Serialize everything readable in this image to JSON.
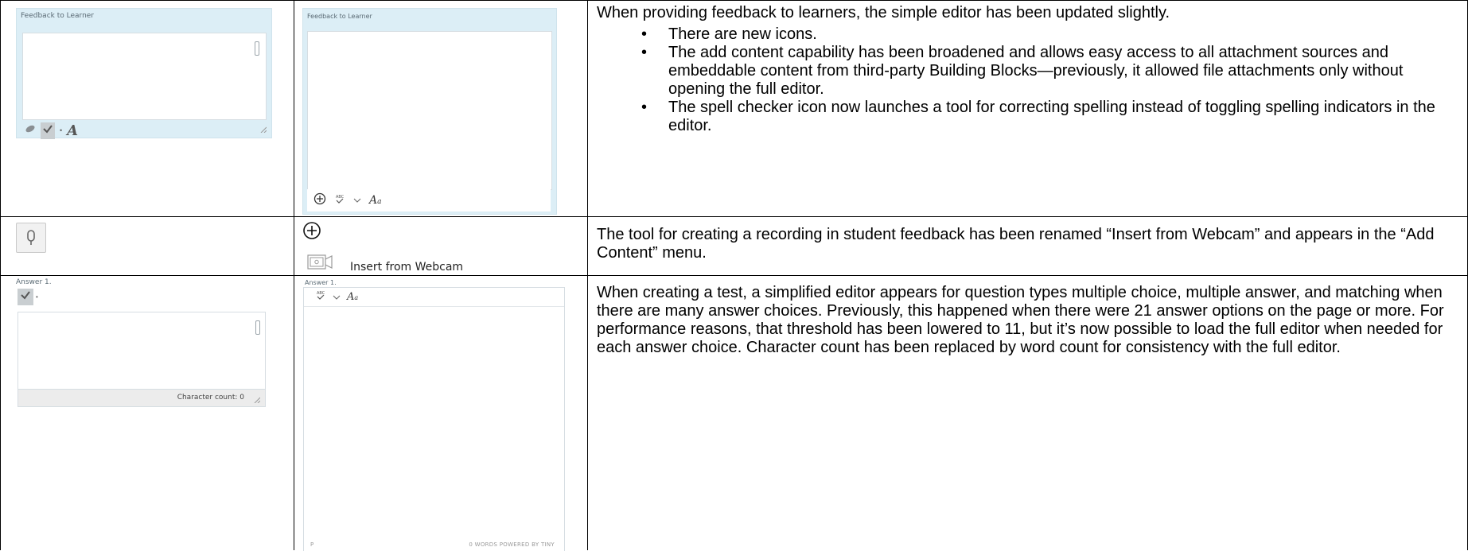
{
  "row1": {
    "old_editor_label": "Feedback to Learner",
    "new_editor_label": "Feedback to Learner",
    "old_toolbar_icons": [
      "paperclip-icon",
      "spellcheck-icon",
      "dropdown-arrow-icon",
      "text-format-icon"
    ],
    "new_toolbar_icons": [
      "add-content-plus-icon",
      "spellcheck-icon",
      "chevron-down-icon",
      "text-format-icon"
    ],
    "description": {
      "intro": "When providing feedback to learners, the simple editor has been updated slightly.",
      "bullets": [
        "There are new icons.",
        "The add content capability has been broadened and allows easy access to all attachment sources and embeddable content from third-party Building Blocks—previously, it allowed file attachments only without opening the full editor.",
        "The spell checker icon now launches a tool for correcting spelling instead of toggling spelling indicators in the editor."
      ]
    }
  },
  "row2": {
    "old_icon": "microphone-icon",
    "new_icon": "add-content-plus-icon",
    "webcam_label": "Insert from Webcam",
    "description": "The tool for creating a recording in student feedback has been renamed “Insert from Webcam” and appears in the “Add Content” menu."
  },
  "row3": {
    "old_answer_label": "Answer 1.",
    "old_status": "Character count: 0",
    "new_answer_label": "Answer 1.",
    "new_status_path": "P",
    "new_status_words": "0 WORDS  POWERED BY TINY",
    "description": "When creating a test, a simplified editor appears for question types multiple choice, multiple answer, and matching when there are many answer choices. Previously, this happened when there were 21 answer options on the page or more. For performance reasons, that threshold has been lowered to 11, but it’s now possible to load the full editor when needed for each answer choice. Character count has been replaced by word count for consistency with the full editor."
  },
  "colors": {
    "editor_frame": "#dceef6",
    "border": "#000000",
    "status_bar": "#ececec"
  }
}
